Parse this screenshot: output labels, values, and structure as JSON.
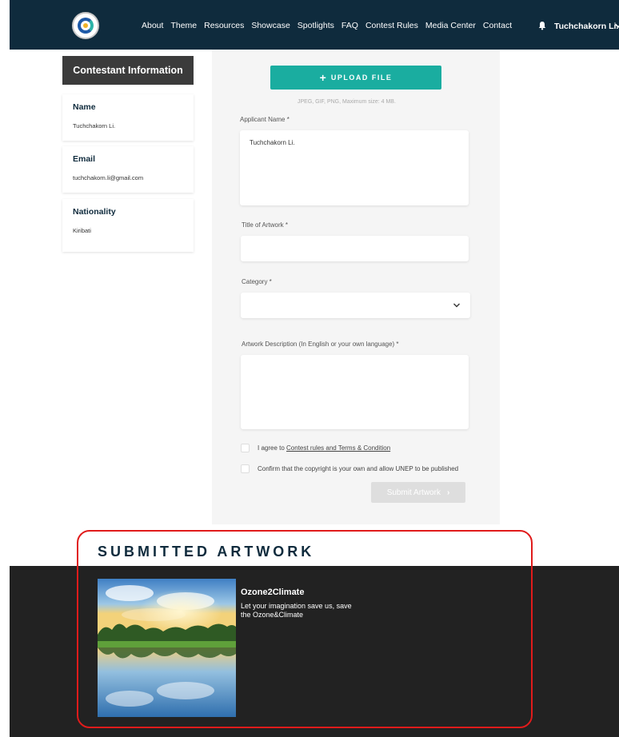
{
  "nav": {
    "links": [
      "About",
      "Theme",
      "Resources",
      "Showcase",
      "Spotlights",
      "FAQ",
      "Contest Rules",
      "Media Center",
      "Contact"
    ],
    "user_name": "Tuchchakorn Li."
  },
  "sidebar": {
    "header": "Contestant Information",
    "cards": [
      {
        "label": "Name",
        "value": "Tuchchakorn Li."
      },
      {
        "label": "Email",
        "value": "tuchchakorn.li@gmail.com"
      },
      {
        "label": "Nationality",
        "value": "Kiribati"
      }
    ]
  },
  "form": {
    "upload_label": "UPLOAD FILE",
    "upload_hint": "JPEG, GIF, PNG, Maximum size: 4 MB.",
    "applicant_name_label": "Applicant Name *",
    "applicant_name_value": "Tuchchakorn Li.",
    "title_label": "Title of Artwork *",
    "title_value": "",
    "category_label": "Category *",
    "category_value": "",
    "description_label": "Artwork Description (In English or your own language) *",
    "description_value": "",
    "agree_prefix": "I agree to ",
    "agree_link": "Contest rules and Terms & Condition",
    "confirm_text": "Confirm that the copyright is your own and allow UNEP to be published",
    "submit_label": "Submit Artwork"
  },
  "submitted": {
    "title": "SUBMITTED ARTWORK",
    "artwork_name": "Ozone2Climate",
    "artwork_desc": "Let your imagination save us, save the Ozone&Climate"
  },
  "colors": {
    "nav_bg": "#0f2b3d",
    "upload_button": "#1aada0",
    "dark_section": "#222222",
    "highlight": "#e01b1b"
  }
}
